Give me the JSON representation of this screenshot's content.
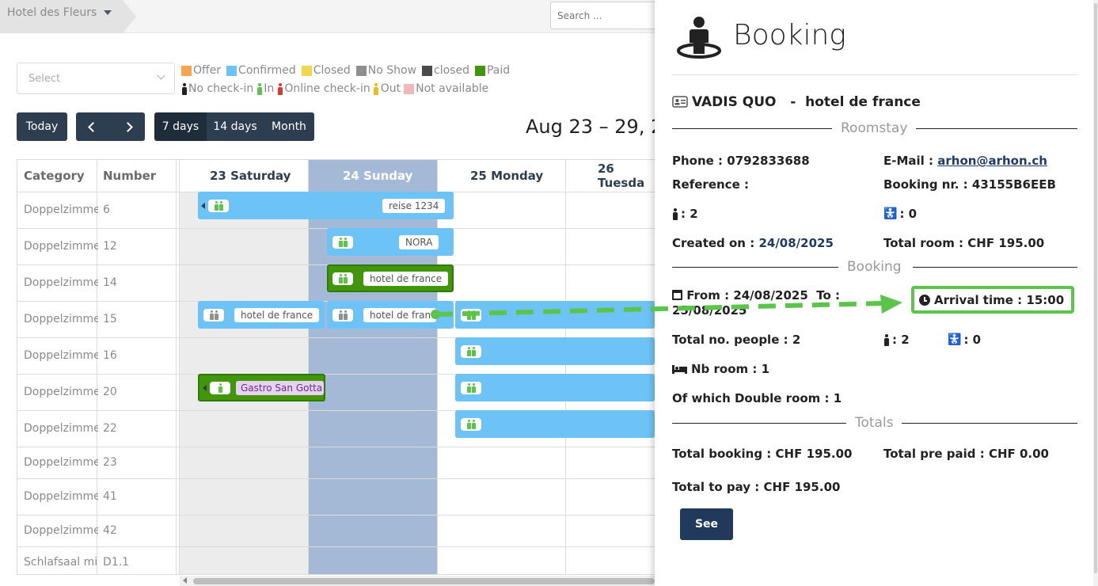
{
  "topbar": {
    "hotel_name": "Hotel des Fleurs",
    "search_placeholder": "Search ..."
  },
  "filters": {
    "select_placeholder": "Select",
    "legend_status": [
      {
        "label": "Offer",
        "color": "#f5a54a"
      },
      {
        "label": "Confirmed",
        "color": "#6ec3f6"
      },
      {
        "label": "Closed",
        "color": "#f2d64b"
      },
      {
        "label": "No Show",
        "color": "#8f8f8f"
      },
      {
        "label": "closed",
        "color": "#4a4a4a"
      },
      {
        "label": "Paid",
        "color": "#41960b"
      }
    ],
    "legend_checkin": [
      {
        "label": "No check-in",
        "color": "#222222"
      },
      {
        "label": "In",
        "color": "#5cc44b"
      },
      {
        "label": "Online check-in",
        "color": "#d9382d"
      },
      {
        "label": "Out",
        "color": "#f2b91b"
      },
      {
        "label": "Not available",
        "color": "#f2b8b8",
        "swatch": true
      }
    ]
  },
  "toolbar": {
    "today": "Today",
    "views": [
      "7 days",
      "14 days",
      "Month"
    ],
    "active_view": "7 days",
    "range": "Aug 23 – 29, 2"
  },
  "grid": {
    "headers": {
      "category": "Category",
      "number": "Number"
    },
    "days": [
      "23 Saturday",
      "24 Sunday",
      "25 Monday",
      "26 Tuesda"
    ],
    "rows": [
      {
        "category": "Doppelzimmer",
        "number": "6"
      },
      {
        "category": "Doppelzimmer",
        "number": "12"
      },
      {
        "category": "Doppelzimmer",
        "number": "14"
      },
      {
        "category": "Doppelzimmer",
        "number": "15"
      },
      {
        "category": "Doppelzimmer",
        "number": "16"
      },
      {
        "category": "Doppelzimmer",
        "number": "20"
      },
      {
        "category": "Doppelzimmer",
        "number": "22"
      },
      {
        "category": "Doppelzimmer",
        "number": "23"
      },
      {
        "category": "Doppelzimmer",
        "number": "41"
      },
      {
        "category": "Doppelzimmer",
        "number": "42"
      },
      {
        "category": "Schlafsaal mi",
        "number": "D1.1"
      }
    ],
    "bookings": [
      {
        "label": "reise 1234"
      },
      {
        "label": "NORA"
      },
      {
        "label": "hotel de france"
      },
      {
        "label": "hotel de france"
      },
      {
        "label": "hotel de franc"
      },
      {
        "label": "Gastro San Gotta"
      }
    ]
  },
  "panel": {
    "title": "Booking",
    "guest": "VADIS QUO",
    "separator": "-",
    "company": "hotel de france",
    "sections": {
      "roomstay": "Roomstay",
      "booking": "Booking",
      "totals": "Totals"
    },
    "phone_label": "Phone :",
    "phone": "0792833688",
    "email_label": "E-Mail :",
    "email": "arhon@arhon.ch",
    "reference_label": "Reference :",
    "booking_nr_label": "Booking nr. :",
    "booking_nr": "43155B6EEB",
    "adults": ": 2",
    "children": ": 0",
    "created_label": "Created on :",
    "created": "24/08/2025",
    "total_room_label": "Total room :",
    "total_room": "CHF 195.00",
    "from_label": "From :",
    "from": "24/08/2025",
    "to_label": "To :",
    "to": "25/08/2025",
    "arrival_label": "Arrival time :",
    "arrival": "15:00",
    "total_people_label": "Total no. people :",
    "total_people": "2",
    "adults2": ": 2",
    "children2": ": 0",
    "nb_room_label": "Nb room :",
    "nb_room": "1",
    "double_room_label": "Of which Double room :",
    "double_room": "1",
    "total_booking_label": "Total booking :",
    "total_booking": "CHF 195.00",
    "total_prepaid_label": "Total pre paid :",
    "total_prepaid": "CHF 0.00",
    "total_to_pay_label": "Total to pay :",
    "total_to_pay": "CHF 195.00",
    "see_button": "See"
  }
}
